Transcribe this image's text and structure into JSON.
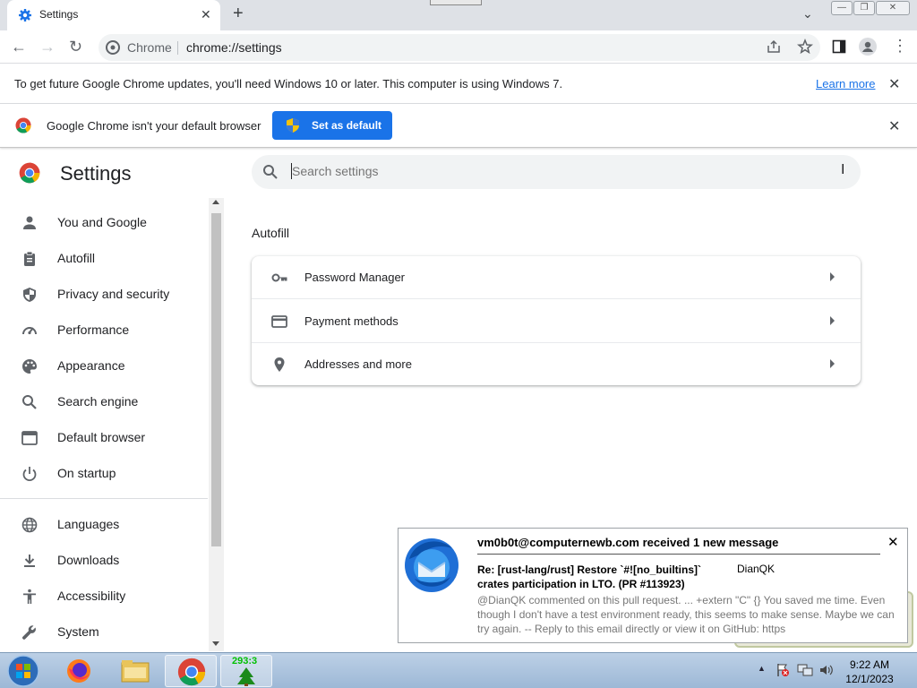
{
  "tab": {
    "title": "Settings",
    "close": "✕",
    "new_tab": "+"
  },
  "window": {
    "minimize": "—",
    "restore": "❐",
    "close": "✕",
    "tab_search": "⌄"
  },
  "toolbar": {
    "back": "←",
    "forward": "→",
    "reload": "↻",
    "chip": "Chrome",
    "url": "chrome://settings",
    "menu": "⋮"
  },
  "infobar_update": {
    "message": "To get future Google Chrome updates, you'll need Windows 10 or later. This computer is using Windows 7.",
    "link": "Learn more",
    "close": "✕"
  },
  "infobar_default": {
    "message": "Google Chrome isn't your default browser",
    "button": "Set as default",
    "close": "✕"
  },
  "settings": {
    "title": "Settings",
    "search_placeholder": "Search settings"
  },
  "sidebar": {
    "items": [
      {
        "label": "You and Google",
        "icon": "person-icon"
      },
      {
        "label": "Autofill",
        "icon": "clipboard-icon"
      },
      {
        "label": "Privacy and security",
        "icon": "shield-icon"
      },
      {
        "label": "Performance",
        "icon": "gauge-icon"
      },
      {
        "label": "Appearance",
        "icon": "palette-icon"
      },
      {
        "label": "Search engine",
        "icon": "search-icon"
      },
      {
        "label": "Default browser",
        "icon": "browser-icon"
      },
      {
        "label": "On startup",
        "icon": "power-icon"
      }
    ],
    "advanced_items": [
      {
        "label": "Languages",
        "icon": "globe-icon"
      },
      {
        "label": "Downloads",
        "icon": "download-icon"
      },
      {
        "label": "Accessibility",
        "icon": "accessibility-icon"
      },
      {
        "label": "System",
        "icon": "wrench-icon"
      }
    ]
  },
  "main": {
    "section": "Autofill",
    "rows": [
      {
        "label": "Password Manager",
        "icon": "key-icon"
      },
      {
        "label": "Payment methods",
        "icon": "credit-card-icon"
      },
      {
        "label": "Addresses and more",
        "icon": "location-pin-icon"
      }
    ]
  },
  "notification": {
    "header": "vm0b0t@computernewb.com received 1 new message",
    "subject": "Re: [rust-lang/rust] Restore `#![no_builtins]` crates participation in LTO. (PR #113923)",
    "from": "DianQK",
    "body": "@DianQK commented on this pull request. ... +extern \"C\" {} You saved me time. Even though I don't have a test environment ready, this seems to make sense. Maybe we can try again. -- Reply to this email directly or view it on GitHub: https",
    "close": "✕"
  },
  "taskbar": {
    "badge": "293:3",
    "time": "9:22 AM",
    "date": "12/1/2023",
    "tray_arrow": "▲"
  },
  "colors": {
    "accent": "#1a73e8",
    "taskbar": "#b0c6df"
  }
}
